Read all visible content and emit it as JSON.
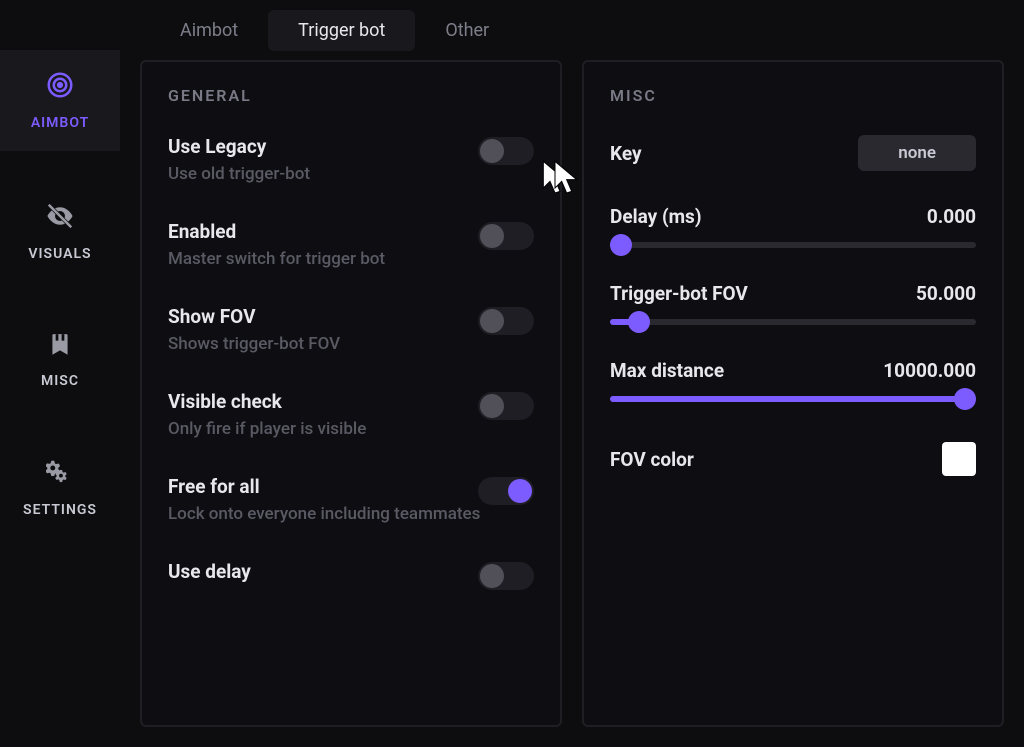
{
  "sidebar": {
    "items": [
      {
        "id": "aimbot",
        "label": "AIMBOT",
        "icon": "target-icon"
      },
      {
        "id": "visuals",
        "label": "VISUALS",
        "icon": "eye-off-icon"
      },
      {
        "id": "misc",
        "label": "MISC",
        "icon": "bookmark-icon"
      },
      {
        "id": "settings",
        "label": "SETTINGS",
        "icon": "gears-icon"
      }
    ],
    "active": "aimbot"
  },
  "tabs": {
    "items": [
      "Aimbot",
      "Trigger bot",
      "Other"
    ],
    "active": "Trigger bot"
  },
  "general": {
    "title": "GENERAL",
    "options": [
      {
        "label": "Use Legacy",
        "desc": "Use old trigger-bot",
        "on": false
      },
      {
        "label": "Enabled",
        "desc": "Master switch for trigger bot",
        "on": false
      },
      {
        "label": "Show FOV",
        "desc": "Shows trigger-bot FOV",
        "on": false
      },
      {
        "label": "Visible check",
        "desc": "Only fire if player is visible",
        "on": false
      },
      {
        "label": "Free for all",
        "desc": "Lock onto everyone including teammates",
        "on": true
      },
      {
        "label": "Use delay",
        "desc": "",
        "on": false
      }
    ]
  },
  "misc": {
    "title": "MISC",
    "key_label": "Key",
    "key_value": "none",
    "sliders": [
      {
        "label": "Delay (ms)",
        "value": "0.000",
        "pct": 3
      },
      {
        "label": "Trigger-bot FOV",
        "value": "50.000",
        "pct": 8
      },
      {
        "label": "Max distance",
        "value": "10000.000",
        "pct": 97
      }
    ],
    "color_label": "FOV color",
    "color_value": "#ffffff"
  }
}
